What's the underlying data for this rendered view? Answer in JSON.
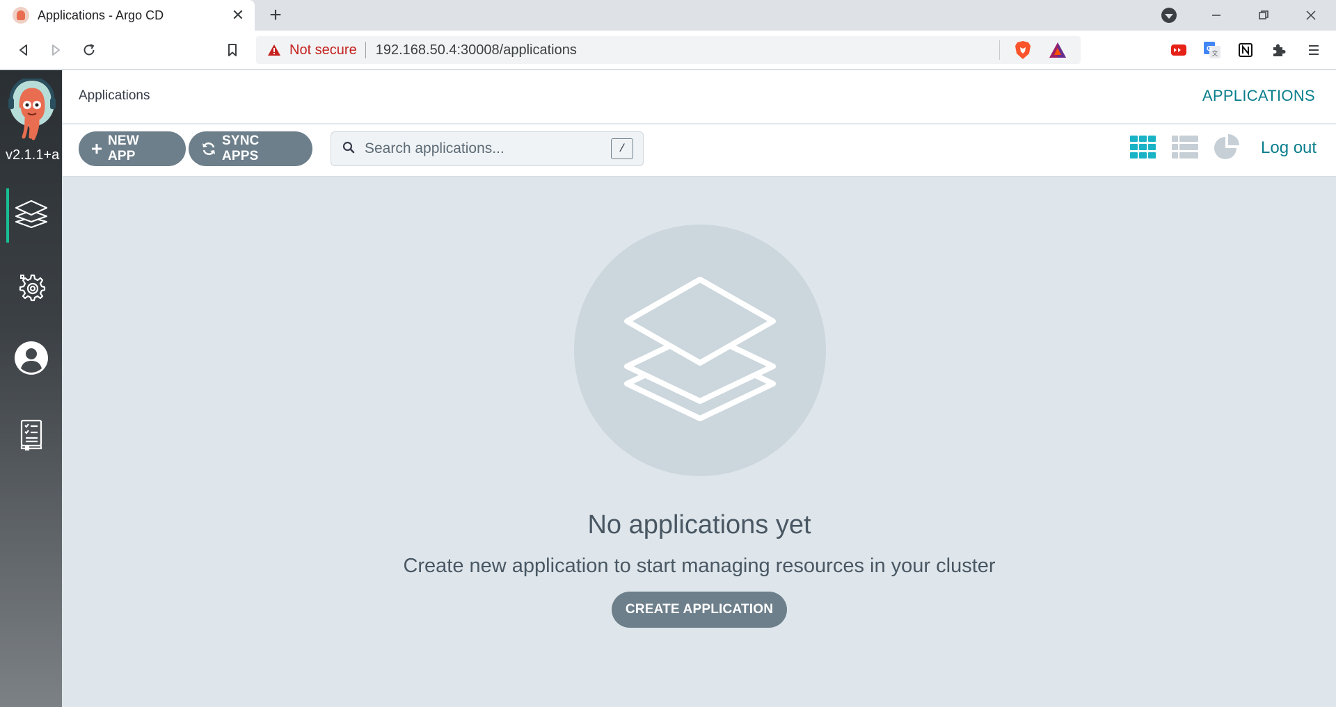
{
  "browser": {
    "tab_title": "Applications - Argo CD",
    "tab_close": "✕",
    "new_tab": "+",
    "security_label": "Not secure",
    "url": "192.168.50.4:30008/applications",
    "window": {
      "minimize": "—",
      "maximize": "❐",
      "close": "✕"
    }
  },
  "sidebar": {
    "version": "v2.1.1+a",
    "items": [
      {
        "id": "applications",
        "icon": "layers-icon",
        "active": true
      },
      {
        "id": "settings",
        "icon": "gear-icon",
        "active": false
      },
      {
        "id": "user-info",
        "icon": "user-icon",
        "active": false
      },
      {
        "id": "documentation",
        "icon": "docs-icon",
        "active": false
      }
    ]
  },
  "header": {
    "breadcrumb": "Applications",
    "title": "APPLICATIONS"
  },
  "toolbar": {
    "new_app_label": "NEW APP",
    "sync_apps_label": "SYNC APPS",
    "search_placeholder": "Search applications...",
    "search_shortcut": "/",
    "views": [
      "tiles-view-icon",
      "list-view-icon",
      "summary-view-icon"
    ],
    "logout_label": "Log out"
  },
  "empty_state": {
    "title": "No applications yet",
    "subtitle": "Create new application to start managing resources in your cluster",
    "button_label": "CREATE APPLICATION"
  },
  "colors": {
    "accent": "#0a7e8c",
    "tile_active": "#1ab3c6",
    "pill": "#6d7f8b",
    "not_secure": "#c5221f",
    "sidebar_active_bar": "#18be94"
  }
}
